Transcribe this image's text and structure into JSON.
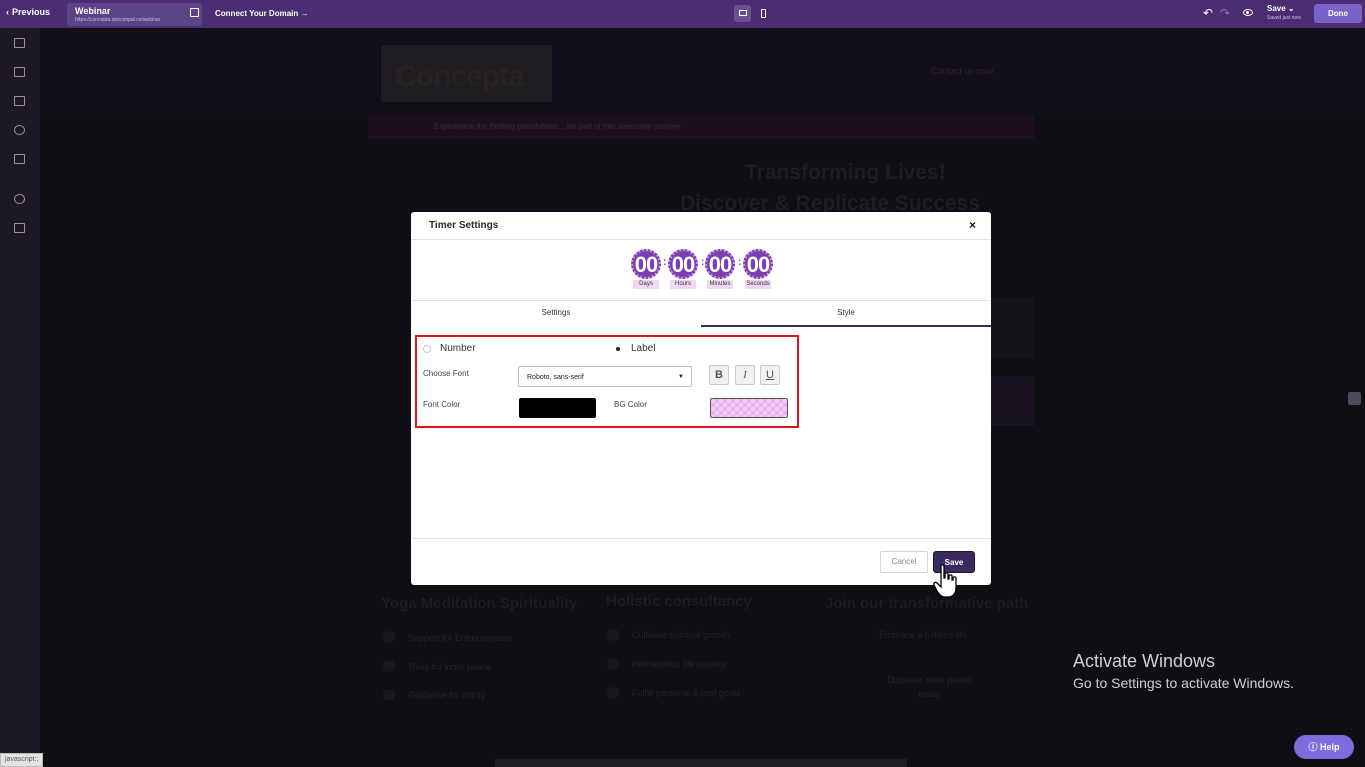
{
  "topbar": {
    "previous_label": "Previous",
    "page_name": "Webinar",
    "page_url": "https://concepta.dotcompal.co/webinar",
    "connect_domain_label": "Connect Your Domain",
    "save_label": "Save",
    "save_status": "Saved just now",
    "done_label": "Done"
  },
  "canvas": {
    "logo_text": "Concepta",
    "contact_link": "Contact us now",
    "banner_text": "Experience the thrilling possibilities... be part of this awesome journey",
    "heading_line1": "Transforming Lives!",
    "heading_line2": "Discover & Replicate Success",
    "columns": [
      {
        "title": "Yoga Meditation Spirituality",
        "items": [
          "Support for Entrepreneurs",
          "Tools for inner peace",
          "Guidance for clarity"
        ]
      },
      {
        "title": "Holistic consultancy",
        "items": [
          "Cultivate spiritual growth",
          "Harmonious life journey",
          "Fulfill personal & prof goals"
        ]
      },
      {
        "title": "Join our transformative path",
        "items": [
          "Embrace a fulfilled life",
          "Discover inner peace today"
        ]
      }
    ]
  },
  "modal": {
    "title": "Timer Settings",
    "timer": [
      {
        "value": "00",
        "label": "Days"
      },
      {
        "value": "00",
        "label": "Hours"
      },
      {
        "value": "00",
        "label": "Minutes"
      },
      {
        "value": "00",
        "label": "Seconds"
      }
    ],
    "tabs": {
      "settings": "Settings",
      "style": "Style"
    },
    "active_tab": "Style",
    "radio_number": "Number",
    "radio_label": "Label",
    "selected_radio": "Label",
    "choose_font_label": "Choose Font",
    "font_value": "Roboto, sans-serif",
    "bold": "B",
    "italic": "I",
    "underline": "U",
    "font_color_label": "Font Color",
    "font_color": "#000000",
    "bg_color_label": "BG Color",
    "bg_color": "#f3c9f5",
    "cancel_label": "Cancel",
    "save_label": "Save"
  },
  "windows": {
    "activate_title": "Activate Windows",
    "activate_sub": "Go to Settings to activate Windows."
  },
  "help_label": "Help",
  "status_text": "javascript:;",
  "colors": {
    "topbar": "#4a2d73",
    "accent": "#3b2a5e",
    "timer": "#7b3fb0",
    "highlight": "#e0141e",
    "done": "#7a62c9"
  }
}
